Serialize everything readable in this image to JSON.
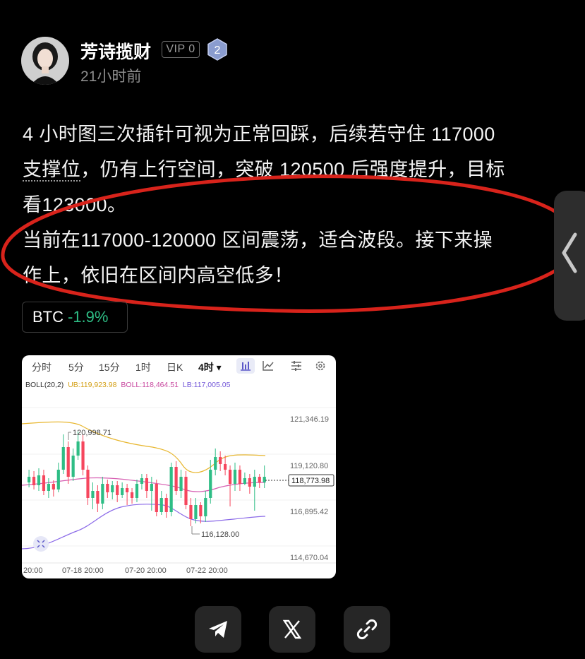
{
  "author": {
    "name": "芳诗揽财",
    "vip_label": "VIP 0",
    "level": "2",
    "time": "21小时前"
  },
  "post": {
    "line1": "4 小时图三次插针可视为正常回踩，后续若守住 117000",
    "line2_underlined": "支撑位",
    "line2_rest": "，仍有上行空间，突破 120500 后强度提升，目标",
    "line3": "看123000。",
    "line4": "当前在117000-120000 区间震荡，适合波段。接下来操",
    "line5": "作上，依旧在区间内高空低多！"
  },
  "coin_tag": {
    "symbol": "BTC",
    "change": "-1.9%"
  },
  "chart": {
    "timeframes": [
      "分时",
      "5分",
      "15分",
      "1时",
      "日K",
      "4时 ▾"
    ],
    "boll_label": "BOLL(20,2)",
    "ub": "UB:119,923.98",
    "boll": "BOLL:118,464.51",
    "lb": "LB:117,005.05",
    "price_labels": [
      "121,346.19",
      "119,120.80",
      "116,895.42",
      "114,670.04"
    ],
    "current_price": "118,773.98",
    "high_label": "120,998.71",
    "low_label": "116,128.00",
    "x_labels": [
      "20:00",
      "07-18 20:00",
      "07-20 20:00",
      "07-22 20:00"
    ],
    "colors": {
      "up": "#2ebd85",
      "down": "#f6465d",
      "ub": "#e8b730",
      "mid": "#d65db1",
      "lb": "#8b6ae8"
    }
  },
  "chart_data": {
    "type": "candlestick",
    "x_ticks": [
      "20:00",
      "07-18 20:00",
      "07-20 20:00",
      "07-22 20:00"
    ],
    "y_ticks": [
      121346.19,
      119120.8,
      116895.42,
      114670.04
    ],
    "ylim": [
      114670.04,
      121346.19
    ],
    "indicator": "BOLL(20,2)",
    "ub": 119923.98,
    "mid": 118464.51,
    "lb": 117005.05,
    "last_price": 118773.98,
    "marked_high": 120998.71,
    "marked_low": 116128.0
  },
  "share": {
    "icons": [
      "telegram-icon",
      "x-icon",
      "link-icon"
    ]
  }
}
